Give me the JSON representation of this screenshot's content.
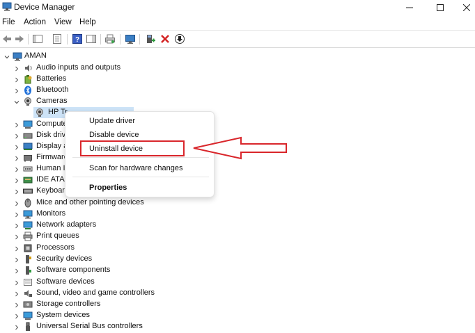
{
  "window": {
    "title": "Device Manager",
    "controls": [
      "minimize",
      "maximize",
      "close"
    ]
  },
  "menubar": {
    "items": [
      "File",
      "Action",
      "View",
      "Help"
    ]
  },
  "toolbar": {
    "buttons": [
      "back-icon",
      "forward-icon",
      "show-hide-console-tree-icon",
      "properties-icon",
      "help-icon",
      "action-pane-icon",
      "print-icon",
      "monitor-icon",
      "add-driver-icon",
      "uninstall-icon",
      "update-driver-icon"
    ]
  },
  "tree": {
    "root": "AMAN",
    "nodes": [
      {
        "label": "Audio inputs and outputs",
        "icon": "speaker-icon"
      },
      {
        "label": "Batteries",
        "icon": "battery-icon"
      },
      {
        "label": "Bluetooth",
        "icon": "bluetooth-icon"
      },
      {
        "label": "Cameras",
        "icon": "camera-icon",
        "expanded": true
      },
      {
        "label": "HP True Vision HD Camera",
        "visible_label": "HP Tr",
        "icon": "webcam-icon",
        "child": true,
        "selected": true
      },
      {
        "label": "Compute",
        "icon": "computer-icon"
      },
      {
        "label": "Disk driv",
        "icon": "disk-drive-icon"
      },
      {
        "label": "Display a",
        "icon": "display-adapter-icon"
      },
      {
        "label": "Firmware",
        "icon": "firmware-icon"
      },
      {
        "label": "Human In",
        "icon": "hid-icon"
      },
      {
        "label": "IDE ATA/A",
        "icon": "ide-icon"
      },
      {
        "label": "Keyboard",
        "icon": "keyboard-icon"
      },
      {
        "label": "Mice and other pointing devices",
        "icon": "mouse-icon"
      },
      {
        "label": "Monitors",
        "icon": "monitor-icon"
      },
      {
        "label": "Network adapters",
        "icon": "network-adapter-icon"
      },
      {
        "label": "Print queues",
        "icon": "printer-icon"
      },
      {
        "label": "Processors",
        "icon": "processor-icon"
      },
      {
        "label": "Security devices",
        "icon": "security-device-icon"
      },
      {
        "label": "Software components",
        "icon": "software-component-icon"
      },
      {
        "label": "Software devices",
        "icon": "software-device-icon"
      },
      {
        "label": "Sound, video and game controllers",
        "icon": "sound-controller-icon"
      },
      {
        "label": "Storage controllers",
        "icon": "storage-controller-icon"
      },
      {
        "label": "System devices",
        "icon": "system-device-icon"
      },
      {
        "label": "Universal Serial Bus controllers",
        "icon": "usb-icon"
      }
    ]
  },
  "context_menu": {
    "items": [
      {
        "label": "Update driver",
        "bold": false
      },
      {
        "label": "Disable device",
        "bold": false
      },
      {
        "label": "Uninstall device",
        "bold": false,
        "highlighted": true
      },
      {
        "label": "Scan for hardware changes",
        "bold": false
      },
      {
        "label": "Properties",
        "bold": true
      }
    ]
  },
  "annotation": {
    "box_color": "#d9262b",
    "arrow_color": "#d9262b"
  }
}
